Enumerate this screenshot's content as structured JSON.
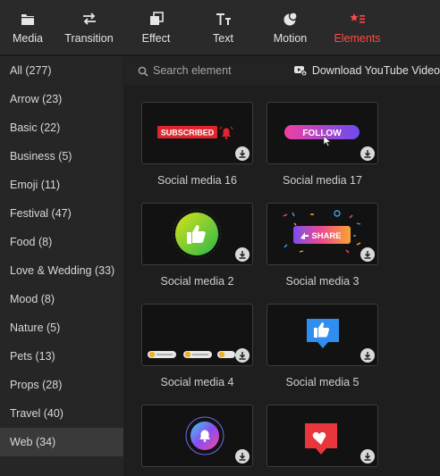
{
  "toolbar": {
    "items": [
      {
        "label": "Media",
        "icon": "folder-icon"
      },
      {
        "label": "Transition",
        "icon": "swap-arrows-icon"
      },
      {
        "label": "Effect",
        "icon": "stacked-squares-icon"
      },
      {
        "label": "Text",
        "icon": "text-icon"
      },
      {
        "label": "Motion",
        "icon": "motion-circles-icon"
      },
      {
        "label": "Elements",
        "icon": "shapes-icon"
      }
    ],
    "active_color": "#ff4a4a"
  },
  "sidebar": {
    "items": [
      {
        "label": "All (277)"
      },
      {
        "label": "Arrow (23)"
      },
      {
        "label": "Basic (22)"
      },
      {
        "label": "Business (5)"
      },
      {
        "label": "Emoji (11)"
      },
      {
        "label": "Festival (47)"
      },
      {
        "label": "Food (8)"
      },
      {
        "label": "Love & Wedding (33)"
      },
      {
        "label": "Mood (8)"
      },
      {
        "label": "Nature (5)"
      },
      {
        "label": "Pets (13)"
      },
      {
        "label": "Props (28)"
      },
      {
        "label": "Travel (40)"
      },
      {
        "label": "Web (34)"
      }
    ],
    "selected": "Web (34)"
  },
  "search": {
    "placeholder": "Search element",
    "download_youtube": "Download YouTube Video"
  },
  "cards": [
    {
      "caption": "Social media 16",
      "thumb_text": "SUBSCRIBED"
    },
    {
      "caption": "Social media 17",
      "thumb_text": "FOLLOW"
    },
    {
      "caption": "Social media 2"
    },
    {
      "caption": "Social media 3",
      "thumb_text": "SHARE"
    },
    {
      "caption": "Social media 4"
    },
    {
      "caption": "Social media 5"
    },
    {
      "caption": ""
    },
    {
      "caption": ""
    }
  ]
}
